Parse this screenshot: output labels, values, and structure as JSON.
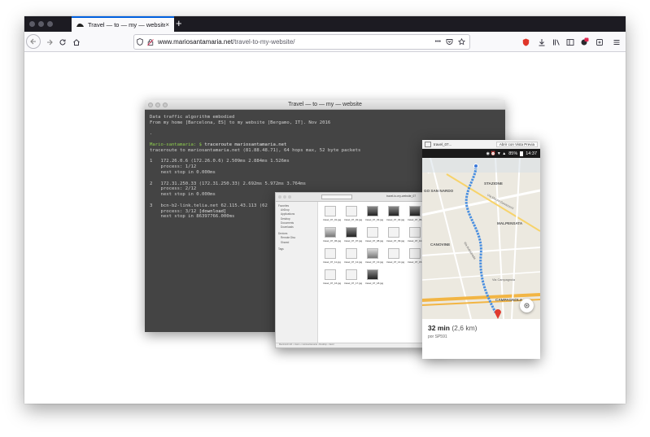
{
  "browser": {
    "tab_title": "Travel — to — my — website",
    "tab_close": "×",
    "new_tab": "+",
    "url_host": "www.mariosantamaria.net",
    "url_path": "/travel-to-my-website/",
    "more_actions": "•••"
  },
  "terminal": {
    "title": "Travel — to — my — website",
    "lines": {
      "l1": "Data traffic algorithm embodied",
      "l2": "From my home [Barcelona, ES] to my website [Bergamo, IT]. Nov 2016",
      "l3": ".",
      "prompt": "Mario-santamaria: $ ",
      "cmd": "traceroute mariosantamaria.net",
      "l5": "traceroute to mariosantamaria.net (81.88.48.71), 64 hops max, 52 byte packets",
      "h1a": "1   172.26.0.6 (172.26.0.6) 2.509ms 2.884ms 1.526ms",
      "h1b": "    process: 1/12",
      "h1c": "    next stop in 0.000ms",
      "h2a": "2   172.31.250.33 (172.31.250.33) 2.692ms 5.972ms 3.764ms",
      "h2b": "    process: 2/12",
      "h2c": "    next stop in 0.000ms",
      "h3a": "3   bcn-b2-link.telia.net 62.115.43.113 (62",
      "h3b": "    process: 3/12 ",
      "h3bb": "[download]",
      "h3c": "    next stop in 86397766.000ms"
    }
  },
  "finder": {
    "window_title": "travel-to-my-website_07",
    "sidebar": [
      "Favorites",
      "AirDrop",
      "Applications",
      "Desktop",
      "Documents",
      "Downloads",
      "Devices",
      "Remote Disc",
      "Shared",
      "Tags"
    ],
    "files": [
      "travel_07_01.jpg",
      "travel_07_02.jpg",
      "travel_07_03.jpg",
      "travel_07_04.jpg",
      "travel_07_05.jpg",
      "travel_07_06.jpg",
      "travel_07_07.jpg",
      "travel_07_08.jpg",
      "travel_07_09.jpg",
      "travel_07_10.jpg",
      "travel_07_11.jpg",
      "travel_07_12.jpg",
      "travel_07_13.jpg",
      "travel_07_14.jpg",
      "travel_07_15.jpg",
      "travel_07_16.jpg",
      "travel_07_17.jpg",
      "travel_07_18.jpg"
    ],
    "status": "Macintosh HD › Users › mariosantamaria › Desktop › travel"
  },
  "phone": {
    "tab_label": "travel_07...",
    "open_label": "Abrir con Vista Previa",
    "battery": "85%",
    "time": "14:37",
    "map_labels": {
      "stazione": "STAZIONE",
      "san_nardo": "GO SAN NARDO",
      "malpensata": "MALPENSATA",
      "canovine": "CANOVINE",
      "campagnola": "CAMPAGNOLA",
      "via_autostrada": "Via Autostrada",
      "via_mauro": "Via Mauro Gavazzeni",
      "via_campagnola": "Via Campagnola"
    },
    "duration": "32 min",
    "distance": "(2,6 km)",
    "via": "por SP591"
  },
  "colors": {
    "accent": "#0060df",
    "terminal_bg": "#444444",
    "route": "#4a8fe0",
    "prompt": "#8fcf4f"
  }
}
